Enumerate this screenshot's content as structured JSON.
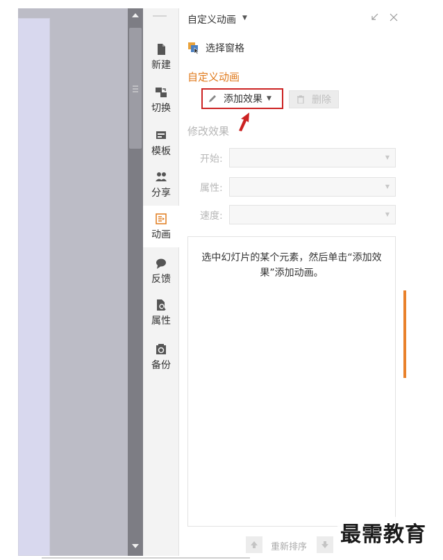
{
  "rail": {
    "items": [
      {
        "label": "新建",
        "icon": "new-file-icon"
      },
      {
        "label": "切换",
        "icon": "switch-icon"
      },
      {
        "label": "模板",
        "icon": "template-icon"
      },
      {
        "label": "分享",
        "icon": "share-icon"
      },
      {
        "label": "动画",
        "icon": "animation-icon",
        "active": true
      },
      {
        "label": "反馈",
        "icon": "feedback-icon"
      },
      {
        "label": "属性",
        "icon": "properties-icon"
      },
      {
        "label": "备份",
        "icon": "backup-icon"
      }
    ]
  },
  "panel": {
    "title": "自定义动画",
    "selection_pane_label": "选择窗格",
    "section_title": "自定义动画",
    "add_effect_label": "添加效果",
    "delete_label": "删除",
    "modify_title": "修改效果",
    "fields": {
      "start_label": "开始:",
      "property_label": "属性:",
      "speed_label": "速度:"
    },
    "empty_hint": "选中幻灯片的某个元素，然后单击“添加效果”添加动画。",
    "reorder_label": "重新排序"
  },
  "watermark": "最需教育",
  "colors": {
    "accent": "#e07a1c",
    "highlight_border": "#cc2222",
    "arrow": "#cc2222",
    "rail_bg": "#f3f3f3",
    "scrollbar": "#7d7d84"
  }
}
